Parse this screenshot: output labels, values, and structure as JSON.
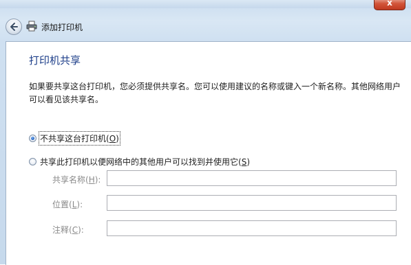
{
  "window": {
    "close_glyph": "x"
  },
  "nav": {
    "title": "添加打印机"
  },
  "main": {
    "heading": "打印机共享",
    "description": "如果要共享这台打印机，您必须提供共享名。您可以使用建议的名称或键入一个新名称。其他网络用户可以看见该共享名。"
  },
  "options": [
    {
      "label": "不共享这台打印机",
      "hotkey": "O",
      "checked": true
    },
    {
      "label": "共享此打印机以便网络中的其他用户可以找到并使用它",
      "hotkey": "S",
      "checked": false
    }
  ],
  "fields": [
    {
      "label": "共享名称",
      "hotkey": "H",
      "value": ""
    },
    {
      "label": "位置",
      "hotkey": "L",
      "value": ""
    },
    {
      "label": "注释",
      "hotkey": "C",
      "value": ""
    }
  ],
  "colors": {
    "heading": "#1e3f8a",
    "disabled_label": "#8a8a8a",
    "radio_fill": "#1f5fbf"
  },
  "icons": {
    "back": "back-arrow-icon",
    "printer": "printer-icon"
  }
}
